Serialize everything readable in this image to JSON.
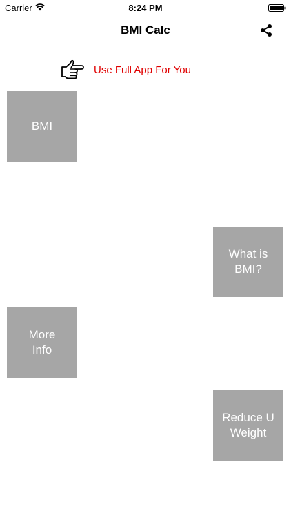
{
  "status_bar": {
    "carrier": "Carrier",
    "time": "8:24 PM",
    "icons": [
      "wifi-icon",
      "battery-icon"
    ]
  },
  "nav_bar": {
    "title": "BMI Calc",
    "right_icon": "share-icon"
  },
  "promo": {
    "icon": "pointing-hand-icon",
    "text": "Use Full App For You",
    "color": "#e00000"
  },
  "tiles": [
    {
      "label": "BMI"
    },
    {
      "label": "What is\nBMI?"
    },
    {
      "label": "More\nInfo"
    },
    {
      "label": "Reduce U\nWeight"
    }
  ],
  "colors": {
    "tile_background": "#a6a6a6",
    "tile_text": "#ffffff",
    "background": "#ffffff"
  }
}
